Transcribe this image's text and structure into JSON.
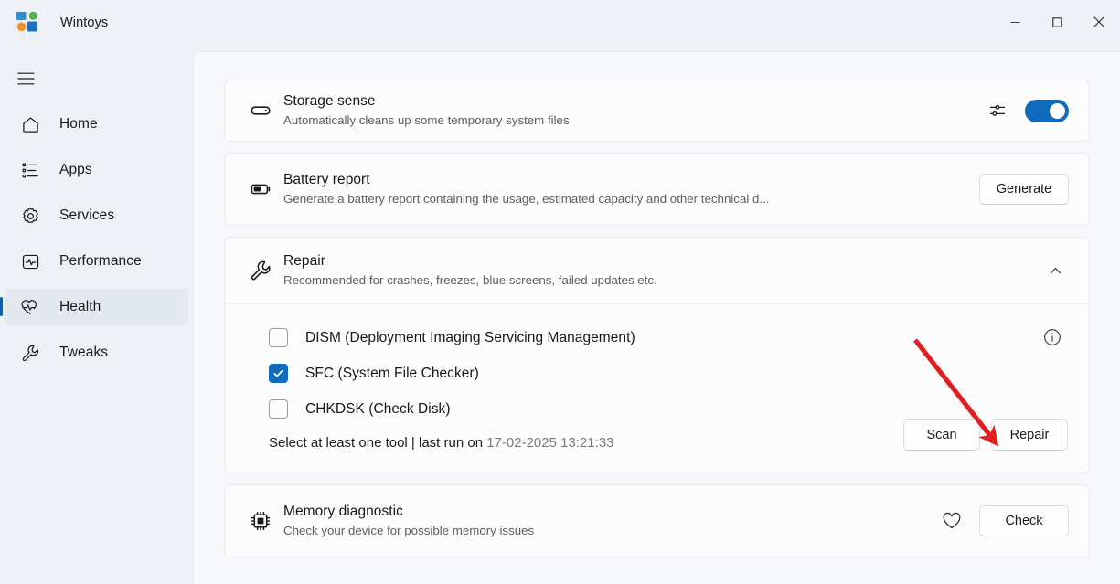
{
  "window": {
    "title": "Wintoys",
    "logo_name": "wintoys-logo",
    "controls": [
      {
        "name": "minimize-button",
        "glyph": "─"
      },
      {
        "name": "maximize-button",
        "glyph": "□"
      },
      {
        "name": "close-button",
        "glyph": "✕"
      }
    ]
  },
  "sidebar": {
    "menu_icon": "hamburger-icon",
    "items": [
      {
        "label": "Home",
        "icon": "home-icon",
        "active": false
      },
      {
        "label": "Apps",
        "icon": "apps-list-icon",
        "active": false
      },
      {
        "label": "Services",
        "icon": "gear-icon",
        "active": false
      },
      {
        "label": "Performance",
        "icon": "performance-monitor-icon",
        "active": false
      },
      {
        "label": "Health",
        "icon": "heart-pulse-icon",
        "active": true
      },
      {
        "label": "Tweaks",
        "icon": "wrench-icon",
        "active": false
      }
    ]
  },
  "cards": {
    "storage_sense": {
      "title": "Storage sense",
      "subtitle": "Automatically cleans up some temporary system files",
      "icon": "storage-drive-icon",
      "settings_icon": "sliders-icon",
      "toggle_state": "on",
      "toggle_color": "#0F6CBD"
    },
    "battery_report": {
      "title": "Battery report",
      "subtitle": "Generate a battery report containing the usage, estimated capacity and other technical d...",
      "icon": "battery-icon",
      "button_label": "Generate"
    },
    "repair": {
      "title": "Repair",
      "subtitle": "Recommended for crashes, freezes, blue screens, failed updates etc.",
      "icon": "wrench-icon",
      "expanded": true,
      "chevron": "chevron-up-icon",
      "info_icon": "info-icon",
      "tools": [
        {
          "label": "DISM (Deployment Imaging Servicing Management)",
          "checked": false
        },
        {
          "label": "SFC (System File Checker)",
          "checked": true
        },
        {
          "label": "CHKDSK (Check Disk)",
          "checked": false
        }
      ],
      "status_prefix": "Select at least one tool | last run on ",
      "status_timestamp": "17-02-2025 13:21:33",
      "scan_label": "Scan",
      "repair_label": "Repair"
    },
    "memory_diagnostic": {
      "title": "Memory diagnostic",
      "subtitle": "Check your device for possible memory issues",
      "icon": "memory-chip-icon",
      "favorite_icon": "heart-icon",
      "button_label": "Check"
    }
  },
  "annotation": {
    "name": "red-arrow-annotation",
    "color": "#E02020",
    "points_to": "Repair"
  }
}
